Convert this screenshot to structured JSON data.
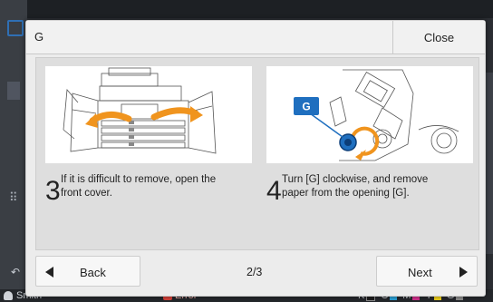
{
  "dialog": {
    "title": "G",
    "close_label": "Close"
  },
  "steps": [
    {
      "number": "3",
      "text": "If it is difficult to remove, open the front cover."
    },
    {
      "number": "4",
      "text": "Turn [G] clockwise, and remove paper from the opening [G]."
    }
  ],
  "callout_label": "G",
  "nav": {
    "back_label": "Back",
    "page_indicator": "2/3",
    "next_label": "Next"
  },
  "statusbar": {
    "user": "Smith",
    "error": "Error",
    "ink_labels": [
      "K",
      "C",
      "M",
      "Y",
      "G"
    ]
  },
  "colors": {
    "accent_blue": "#1f6fbf",
    "arrow_orange": "#f0941e",
    "error_red": "#d9423a",
    "ink_k": "#1e1e1e",
    "ink_c": "#2aa2d8",
    "ink_m": "#d6308f",
    "ink_y": "#f2d21b",
    "ink_g": "#8c8c8c"
  }
}
